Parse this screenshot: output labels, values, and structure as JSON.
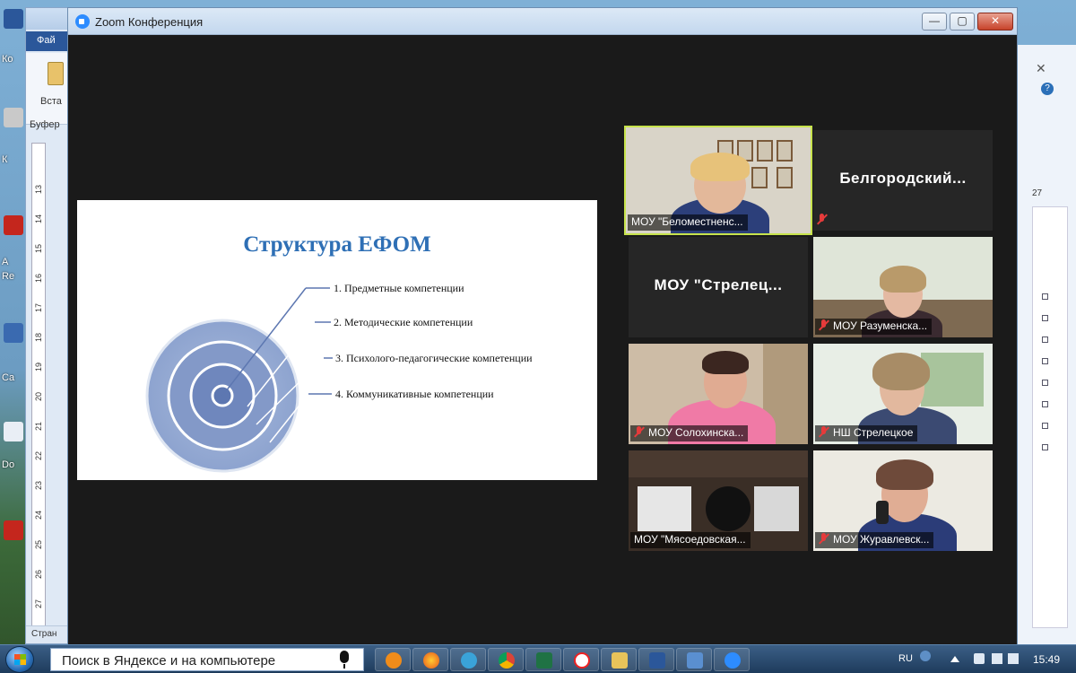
{
  "window": {
    "title": "Zoom Конференция",
    "minimize": "—",
    "maximize": "▢",
    "close": "✕"
  },
  "background_word": {
    "file_tab": "Фай",
    "paste_label": "Вста",
    "clipboard_label": "Буфер",
    "status_label": "Стран",
    "ruler_numbers": [
      "13",
      "14",
      "15",
      "16",
      "17",
      "18",
      "19",
      "20",
      "21",
      "22",
      "23",
      "24",
      "25",
      "26",
      "27"
    ],
    "right_ruler_value": "27",
    "right_close": "✕",
    "right_help": "?"
  },
  "desktop_labels": [
    "Ко",
    "К",
    "А",
    "Re",
    "Ca",
    "Do"
  ],
  "slide": {
    "title": "Структура ЕФОМ",
    "competencies": [
      "1. Предметные компетенции",
      "2. Методические компетенции",
      "3. Психолого-педагогические компетенции",
      "4. Коммуникативные компетенции"
    ]
  },
  "participants": [
    {
      "name": "МОУ \"Беломестненс...",
      "type": "video",
      "muted": false,
      "active": true
    },
    {
      "name": "Белгородский...",
      "type": "name",
      "muted": true,
      "active": false
    },
    {
      "name": "МОУ  \"Стрелец...",
      "type": "name",
      "muted": false,
      "active": false
    },
    {
      "name": "МОУ Разуменска...",
      "type": "video",
      "muted": true,
      "active": false
    },
    {
      "name": "МОУ Солохинска...",
      "type": "video",
      "muted": true,
      "active": false
    },
    {
      "name": "НШ Стрелецкое",
      "type": "video",
      "muted": true,
      "active": false
    },
    {
      "name": "МОУ \"Мясоедовская...",
      "type": "video",
      "muted": false,
      "active": false
    },
    {
      "name": "МОУ Журавлевск...",
      "type": "video",
      "muted": true,
      "active": false
    }
  ],
  "taskbar": {
    "search_placeholder": "Поиск в Яндексе и на компьютере",
    "language": "RU",
    "time": "15:49",
    "apps": [
      "media-player-icon",
      "firefox-icon",
      "network-icon",
      "chrome-icon",
      "excel-icon",
      "yandex-icon",
      "folder-icon",
      "word-icon",
      "chat-icon",
      "zoom-icon"
    ]
  },
  "colors": {
    "active_speaker_border": "#c7e34c",
    "slide_title": "#2e6fb5",
    "mute_red": "#e63b3b",
    "zoom_blue": "#2d8cff"
  }
}
